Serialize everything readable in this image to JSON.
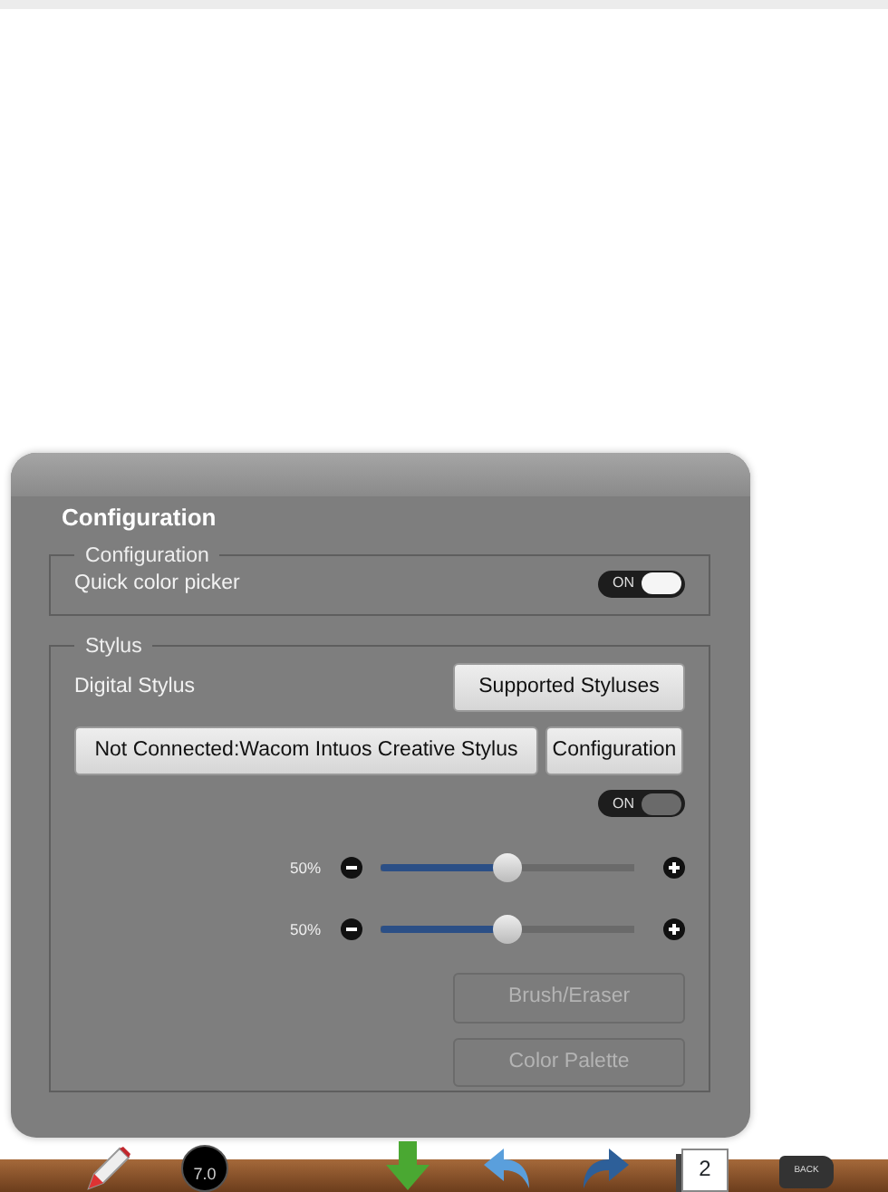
{
  "panel": {
    "title": "Configuration"
  },
  "quick": {
    "legend": "Configuration",
    "label": "Quick color picker",
    "switch": {
      "on": true,
      "disabled": false,
      "text": "ON"
    }
  },
  "stylus": {
    "legend": "Stylus",
    "label": "Digital Stylus",
    "supported_button": "Supported Styluses",
    "connect_button": "Not Connected:Wacom Intuos Creative Stylus",
    "config_button": "Configuration",
    "switch": {
      "on": true,
      "disabled": true,
      "text": "ON"
    },
    "sliders": [
      {
        "reading": "50%",
        "level": 0.5
      },
      {
        "reading": "50%",
        "level": 0.5
      }
    ],
    "buttons": [
      {
        "label": "Brush/Eraser",
        "disabled": true
      },
      {
        "label": "Color Palette",
        "disabled": true
      }
    ]
  },
  "toolbar": [
    {
      "kind": "pencil"
    },
    {
      "kind": "brush",
      "text": "7.0"
    },
    {
      "kind": "download"
    },
    {
      "kind": "undo"
    },
    {
      "kind": "redo"
    },
    {
      "kind": "pages",
      "text": "2"
    },
    {
      "kind": "back",
      "text": "BACK"
    }
  ]
}
